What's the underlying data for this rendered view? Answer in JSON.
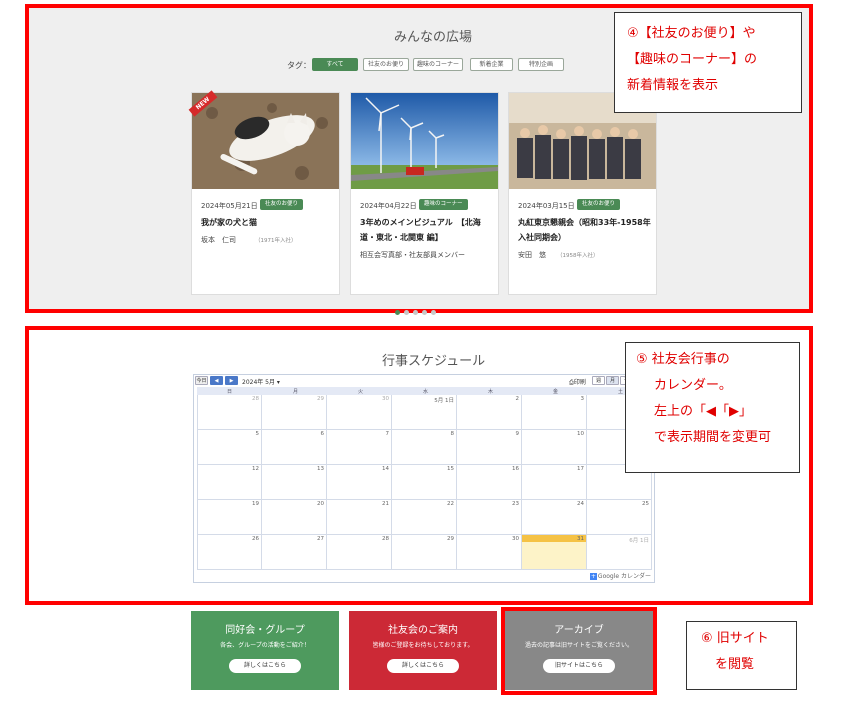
{
  "plaza": {
    "title": "みんなの広場",
    "tags_label": "タグ：",
    "tags": [
      "すべて",
      "社友のお便り",
      "趣味のコーナー",
      "新着企業",
      "特別企画"
    ],
    "cards": [
      {
        "badge": "NEW",
        "date": "2024年05月21日",
        "category": "社友のお便り",
        "title": "我が家の犬と猫",
        "author": "坂本　仁司",
        "year": "（1971年入社）"
      },
      {
        "date": "2024年04月22日",
        "category": "趣味のコーナー",
        "title": "3年めのメインビジュアル　【北海道・東北・北関東 編】",
        "author": "相互会写真部・社友部員メンバー"
      },
      {
        "date": "2024年03月15日",
        "category": "社友のお便り",
        "title": "丸紅東京懇親会（昭和33年-1958年入社同期会）",
        "author": "安田　悠",
        "year": "（1958年入社）"
      }
    ]
  },
  "note4": {
    "line1": "④【社友のお便り】や",
    "line2": "【趣味のコーナー】の",
    "line3": "新着情報を表示"
  },
  "schedule": {
    "title": "行事スケジュール",
    "today_btn": "今日",
    "prev": "◀",
    "next": "▶",
    "month": "2024年 5月 ▾",
    "print": "印刷",
    "view_week": "週",
    "view_month": "月",
    "view_agenda": "予定",
    "weekdays": [
      "日",
      "月",
      "火",
      "水",
      "木",
      "金",
      "土"
    ],
    "rows": [
      [
        "28",
        "29",
        "30",
        "5月 1日",
        "2",
        "3",
        "4"
      ],
      [
        "5",
        "6",
        "7",
        "8",
        "9",
        "10",
        "11"
      ],
      [
        "12",
        "13",
        "14",
        "15",
        "16",
        "17",
        "18"
      ],
      [
        "19",
        "20",
        "21",
        "22",
        "23",
        "24",
        "25"
      ],
      [
        "26",
        "27",
        "28",
        "29",
        "30",
        "31",
        "6月 1日"
      ]
    ],
    "footer": "Google カレンダー"
  },
  "note5": {
    "line1": "⑤ 社友会行事の",
    "line2": "カレンダー。",
    "line3": "左上の「◀「▶」",
    "line4": "で表示期間を変更可"
  },
  "banners": [
    {
      "title": "同好会・グループ",
      "desc": "各会、グループの活動をご紹介！",
      "button": "詳しくはこちら",
      "color": "#4e9a5e"
    },
    {
      "title": "社友会のご案内",
      "desc": "皆様のご登録をお待ちしております。",
      "button": "詳しくはこちら",
      "color": "#cc2936"
    },
    {
      "title": "アーカイブ",
      "desc": "過去の記事は旧サイトをご覧ください。",
      "button": "旧サイトはこちら",
      "color": "#888888"
    }
  ],
  "note6": {
    "line1": "⑥ 旧サイト",
    "line2": "を閲覧"
  }
}
